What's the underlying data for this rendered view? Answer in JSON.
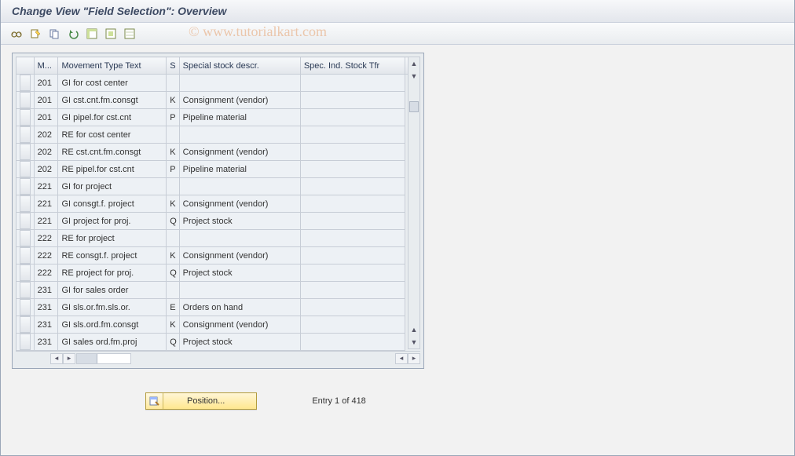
{
  "title": "Change View \"Field Selection\": Overview",
  "watermark": "© www.tutorialkart.com",
  "toolbar": {
    "buttons": [
      {
        "name": "toggle-display-change",
        "icon": "glasses"
      },
      {
        "name": "new-entries",
        "icon": "page"
      },
      {
        "name": "copy-as",
        "icon": "copy"
      },
      {
        "name": "undo",
        "icon": "undo"
      },
      {
        "name": "select-all",
        "icon": "select-all"
      },
      {
        "name": "select-block",
        "icon": "select-block"
      },
      {
        "name": "deselect-all",
        "icon": "deselect"
      }
    ]
  },
  "grid": {
    "columns": {
      "sel": "",
      "mt": "M...",
      "txt": "Movement Type Text",
      "s": "S",
      "desc": "Special stock descr.",
      "tfr": "Spec. Ind. Stock Tfr"
    },
    "rows": [
      {
        "mt": "201",
        "txt": "GI for cost center",
        "s": "",
        "desc": "",
        "tfr": ""
      },
      {
        "mt": "201",
        "txt": "GI cst.cnt.fm.consgt",
        "s": "K",
        "desc": "Consignment (vendor)",
        "tfr": ""
      },
      {
        "mt": "201",
        "txt": "GI pipel.for cst.cnt",
        "s": "P",
        "desc": "Pipeline material",
        "tfr": ""
      },
      {
        "mt": "202",
        "txt": "RE for cost center",
        "s": "",
        "desc": "",
        "tfr": ""
      },
      {
        "mt": "202",
        "txt": "RE cst.cnt.fm.consgt",
        "s": "K",
        "desc": "Consignment (vendor)",
        "tfr": ""
      },
      {
        "mt": "202",
        "txt": "RE pipel.for cst.cnt",
        "s": "P",
        "desc": "Pipeline material",
        "tfr": ""
      },
      {
        "mt": "221",
        "txt": "GI for project",
        "s": "",
        "desc": "",
        "tfr": ""
      },
      {
        "mt": "221",
        "txt": "GI consgt.f. project",
        "s": "K",
        "desc": "Consignment (vendor)",
        "tfr": ""
      },
      {
        "mt": "221",
        "txt": "GI project for proj.",
        "s": "Q",
        "desc": "Project stock",
        "tfr": ""
      },
      {
        "mt": "222",
        "txt": "RE for project",
        "s": "",
        "desc": "",
        "tfr": ""
      },
      {
        "mt": "222",
        "txt": "RE consgt.f. project",
        "s": "K",
        "desc": "Consignment (vendor)",
        "tfr": ""
      },
      {
        "mt": "222",
        "txt": "RE project for proj.",
        "s": "Q",
        "desc": "Project stock",
        "tfr": ""
      },
      {
        "mt": "231",
        "txt": "GI for sales order",
        "s": "",
        "desc": "",
        "tfr": ""
      },
      {
        "mt": "231",
        "txt": "GI sls.or.fm.sls.or.",
        "s": "E",
        "desc": "Orders on hand",
        "tfr": ""
      },
      {
        "mt": "231",
        "txt": "GI sls.ord.fm.consgt",
        "s": "K",
        "desc": "Consignment (vendor)",
        "tfr": ""
      },
      {
        "mt": "231",
        "txt": "GI sales ord.fm.proj",
        "s": "Q",
        "desc": "Project stock",
        "tfr": ""
      }
    ]
  },
  "footer": {
    "position_label": "Position...",
    "entry_text": "Entry 1 of 418"
  }
}
